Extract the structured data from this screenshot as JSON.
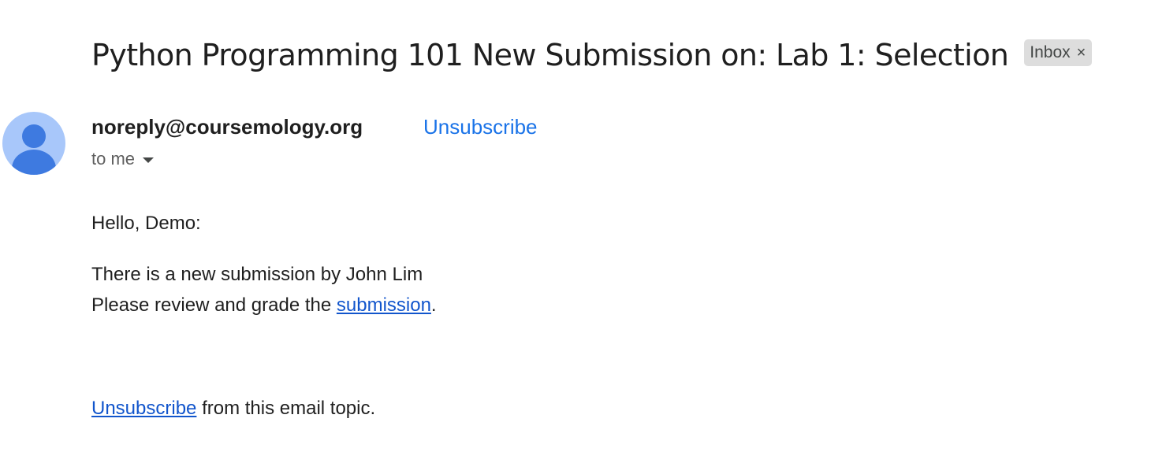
{
  "email": {
    "subject": "Python Programming 101 New Submission on: Lab 1: Selection",
    "label": "Inbox",
    "label_remove": "×",
    "sender": "noreply@coursemology.org",
    "header_unsubscribe": "Unsubscribe",
    "recipient": "to me",
    "avatar_icon": "person-icon",
    "body": {
      "greeting": "Hello, Demo:",
      "line1": "There is a new submission by John Lim",
      "line2_prefix": "Please review and grade the ",
      "line2_link": "submission",
      "line2_suffix": ".",
      "footer_link": "Unsubscribe",
      "footer_suffix": " from this email topic."
    }
  },
  "colors": {
    "link_header": "#1a73e8",
    "link_body": "#1155cc",
    "avatar_bg": "#a8c7fa",
    "avatar_fg": "#3e7ae0",
    "chip_bg": "#dddddd"
  }
}
